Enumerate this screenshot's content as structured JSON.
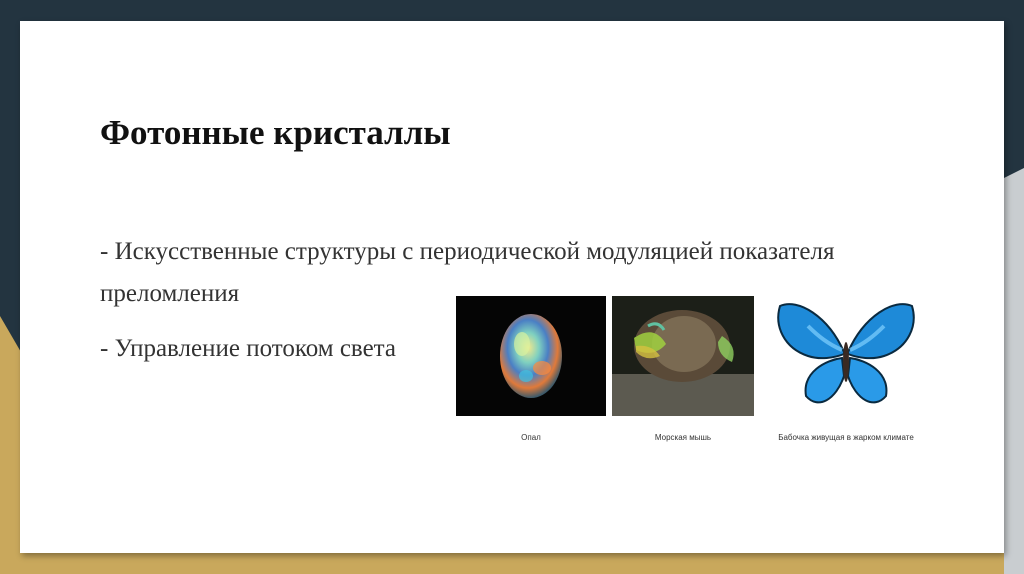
{
  "slide": {
    "title": "Фотонные кристаллы",
    "bullets": [
      "- Искусственные структуры с периодической модуляцией показателя преломления",
      "- Управление потоком света"
    ],
    "images": [
      {
        "caption": "Опал"
      },
      {
        "caption": "Морская мышь"
      },
      {
        "caption": "Бабочка живущая в жарком климате"
      }
    ]
  },
  "colors": {
    "frame_dark": "#233440",
    "frame_gold": "#c9a85c",
    "slide_bg": "#ffffff"
  }
}
